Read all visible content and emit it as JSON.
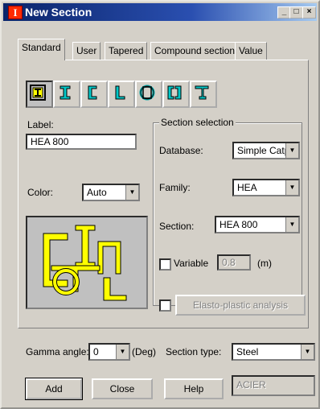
{
  "window": {
    "title": "New Section",
    "min": "_",
    "max": "□",
    "close": "×"
  },
  "tabs": [
    "Standard",
    "User",
    "Tapered",
    "Compound sections",
    "Value"
  ],
  "section_icons": [
    "composite-section-icon",
    "i-beam-icon",
    "channel-icon",
    "angle-icon",
    "pipe-icon",
    "double-channel-icon",
    "tee-icon"
  ],
  "label": {
    "caption": "Label:",
    "value": "HEA 800"
  },
  "color": {
    "caption": "Color:",
    "value": "Auto"
  },
  "section_selection": {
    "title": "Section selection",
    "database_label": "Database:",
    "database_value": "Simple Catpr",
    "family_label": "Family:",
    "family_value": "HEA",
    "section_label": "Section:",
    "section_value": "HEA 800",
    "variable_label": "Variable",
    "variable_value": "0.8",
    "variable_unit": "(m)"
  },
  "elasto_plastic": "Elasto-plastic analysis",
  "gamma": {
    "label": "Gamma angle:",
    "value": "0",
    "unit": "(Deg)"
  },
  "section_type": {
    "label": "Section type:",
    "value": "Steel"
  },
  "buttons": {
    "add": "Add",
    "close": "Close",
    "help": "Help"
  },
  "material_field": "ACIER",
  "colors": {
    "accent_yellow": "#ffff00",
    "title_blue": "#0a246a",
    "icon_cyan": "#00c8c8"
  }
}
